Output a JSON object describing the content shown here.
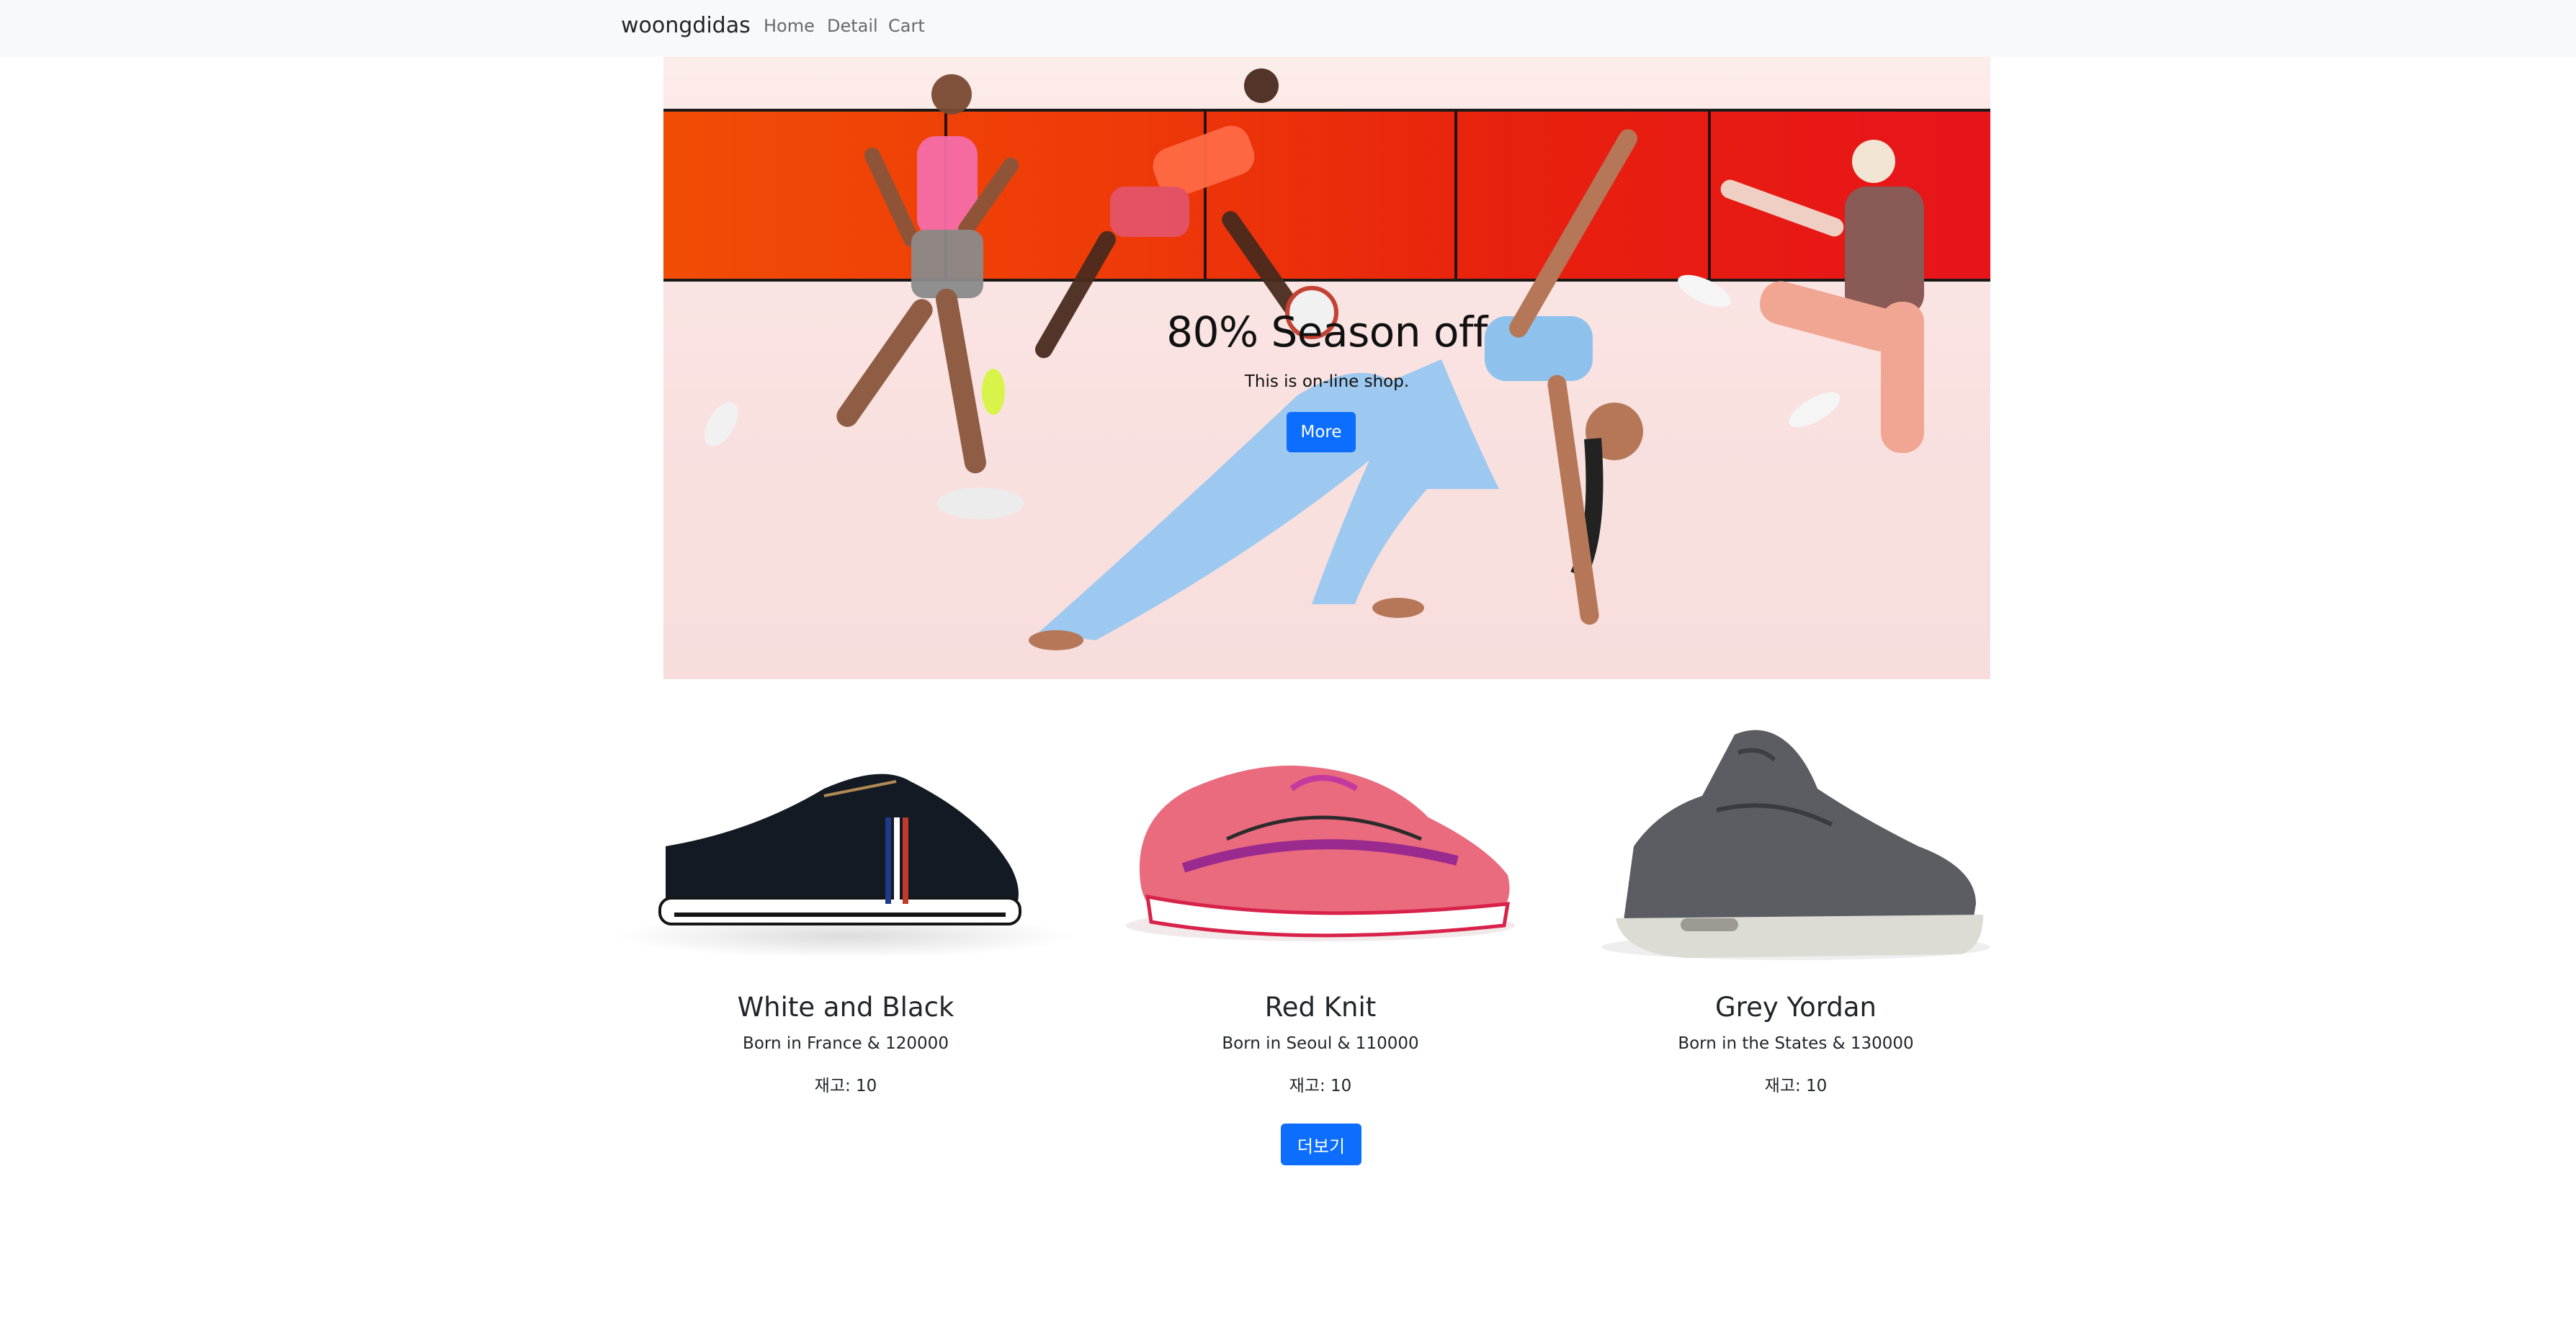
{
  "navbar": {
    "brand": "woongdidas",
    "links": [
      "Home",
      "Detail",
      "Cart"
    ]
  },
  "hero": {
    "title": "80% Season off",
    "subtitle": "This is on-line shop.",
    "button_label": "More"
  },
  "products": [
    {
      "name": "White and Black",
      "desc": "Born in France & 120000",
      "stock": "재고: 10",
      "image_icon": "black-sneaker-icon"
    },
    {
      "name": "Red Knit",
      "desc": "Born in Seoul & 110000",
      "stock": "재고: 10",
      "image_icon": "pink-running-shoe-icon"
    },
    {
      "name": "Grey Yordan",
      "desc": "Born in the States & 130000",
      "stock": "재고: 10",
      "image_icon": "grey-high-top-icon"
    }
  ],
  "more_button_label": "더보기",
  "colors": {
    "primary": "#0d6efd",
    "navbar_bg": "#f8f9fa"
  }
}
